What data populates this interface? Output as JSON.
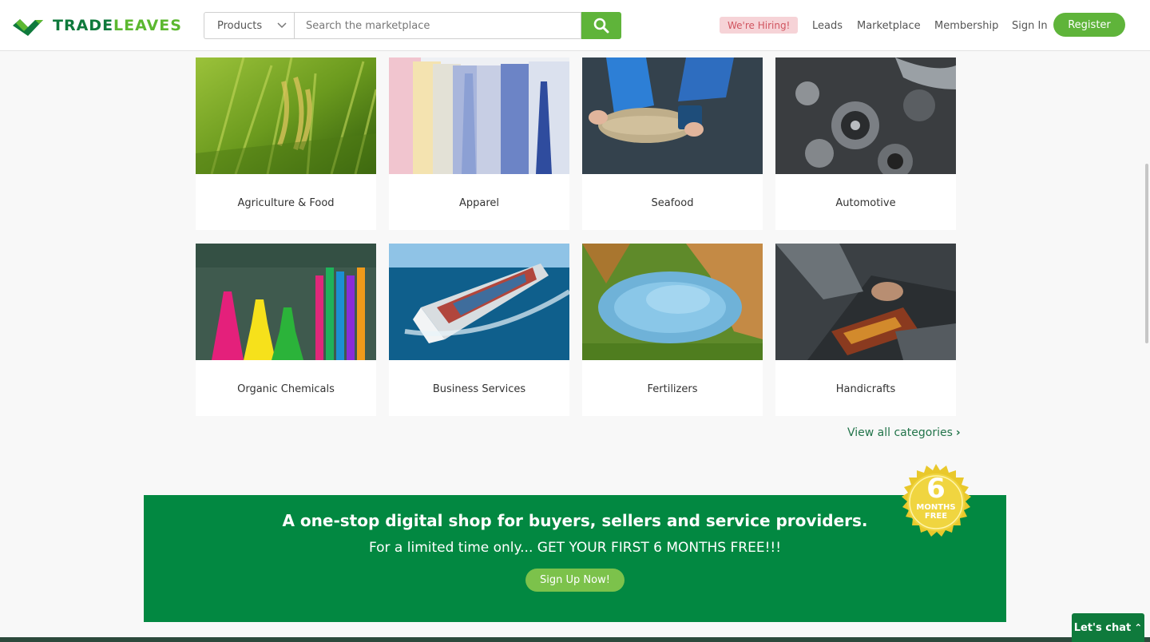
{
  "header": {
    "logo_part1": "TRADE",
    "logo_part2": "LEAVES",
    "search": {
      "category_selected": "Products",
      "placeholder": "Search the marketplace"
    },
    "hiring_badge": "We're Hiring!",
    "nav": {
      "leads": "Leads",
      "marketplace": "Marketplace",
      "membership": "Membership",
      "signin": "Sign In",
      "register": "Register"
    }
  },
  "categories": [
    {
      "label": "Agriculture & Food"
    },
    {
      "label": "Apparel"
    },
    {
      "label": "Seafood"
    },
    {
      "label": "Automotive"
    },
    {
      "label": "Organic Chemicals"
    },
    {
      "label": "Business Services"
    },
    {
      "label": "Fertilizers"
    },
    {
      "label": "Handicrafts"
    }
  ],
  "view_all": "View all categories",
  "banner": {
    "headline": "A one-stop digital shop for buyers, sellers and service providers.",
    "subline": "For a limited time only... GET YOUR FIRST 6 MONTHS FREE!!!",
    "cta": "Sign Up Now!",
    "seal_number": "6",
    "seal_line1": "MONTHS",
    "seal_line2": "FREE"
  },
  "chat": {
    "label": "Let's chat"
  },
  "colors": {
    "brand_dark": "#0f7a3c",
    "brand_light": "#5fb43a",
    "banner_bg": "#028841",
    "hiring_bg": "#f6d3d7",
    "hiring_text": "#d0545f"
  }
}
